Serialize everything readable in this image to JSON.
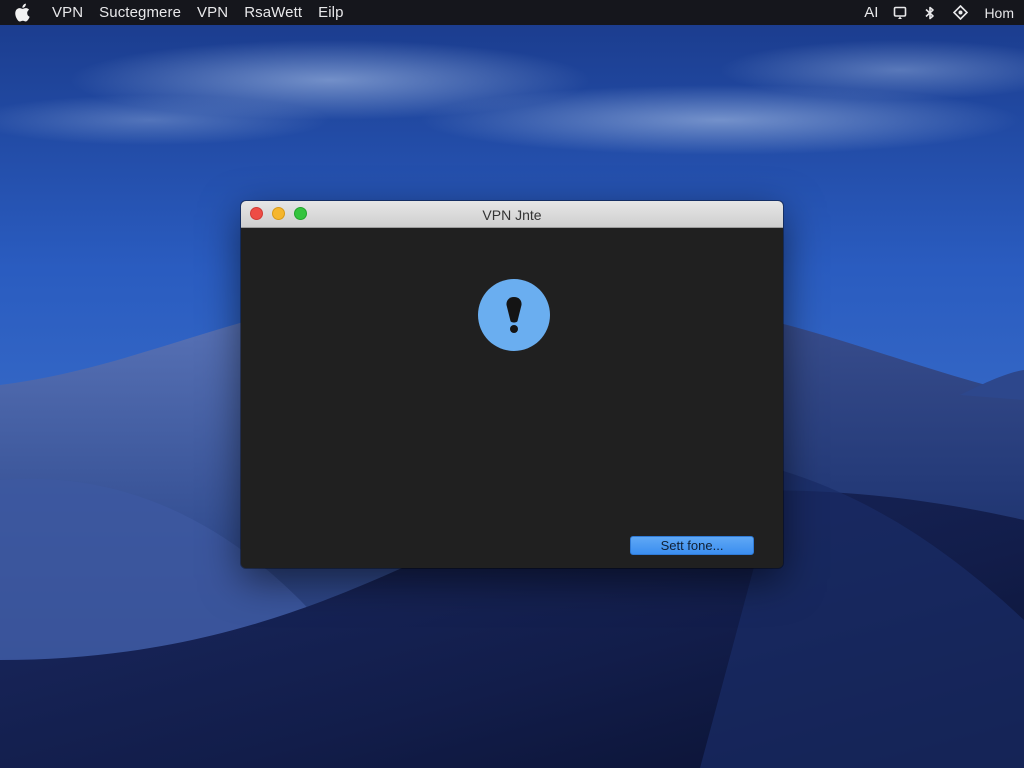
{
  "menubar": {
    "items": [
      "VPN",
      "Suctegmere",
      "VPN",
      "RsaWett",
      "Eilp"
    ],
    "status": {
      "ai_label": "AI",
      "clock": "Hom"
    }
  },
  "window": {
    "title": "VPN Jnte",
    "icon": "exclamation-icon",
    "button_label": "Sett fone..."
  },
  "colors": {
    "accent": "#3b8ef0",
    "alert_icon": "#6aaef0",
    "window_bg": "#202020",
    "menubar_bg": "#15161c"
  }
}
